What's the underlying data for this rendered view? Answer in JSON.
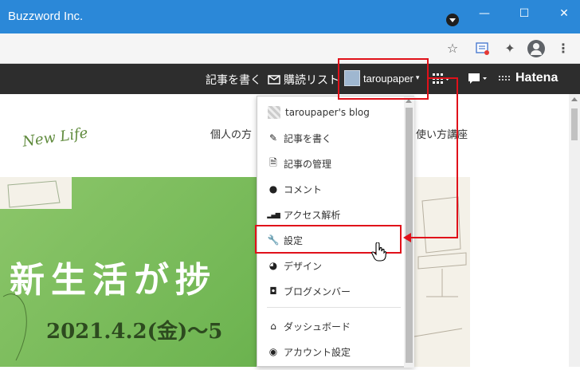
{
  "window": {
    "title": "Buzzword Inc.",
    "minimize": "—",
    "maximize": "☐",
    "close": "✕"
  },
  "toolbar": {
    "star": "☆",
    "extensions": "✦"
  },
  "hatena_bar": {
    "write_article": "記事を書く",
    "reading_list": "購読リスト",
    "username": "taroupaper",
    "caret": "▾",
    "logo": "Hatena"
  },
  "content": {
    "nav_left": "個人の方",
    "nav_right": "使い方講座"
  },
  "banner": {
    "new_life": "New Life",
    "title": "新生活が捗",
    "date": "2021.4.2(金)〜5"
  },
  "dropdown": {
    "blog_name": "taroupaper's blog",
    "items": [
      {
        "label": "記事を書く",
        "icon": "✎"
      },
      {
        "label": "記事の管理",
        "icon": "🗎"
      },
      {
        "label": "コメント",
        "icon": "●"
      },
      {
        "label": "アクセス解析",
        "icon": "▂▄▆"
      },
      {
        "label": "設定",
        "icon": "🔧"
      },
      {
        "label": "デザイン",
        "icon": "◕"
      },
      {
        "label": "ブログメンバー",
        "icon": "◘"
      },
      {
        "label": "ダッシュボード",
        "icon": "⌂"
      },
      {
        "label": "アカウント設定",
        "icon": "◉"
      }
    ]
  },
  "colors": {
    "titlebar": "#2b88d8",
    "hatena_bar": "#2d2d2d",
    "highlight": "#e0111a",
    "banner_green": "#6fb552"
  }
}
